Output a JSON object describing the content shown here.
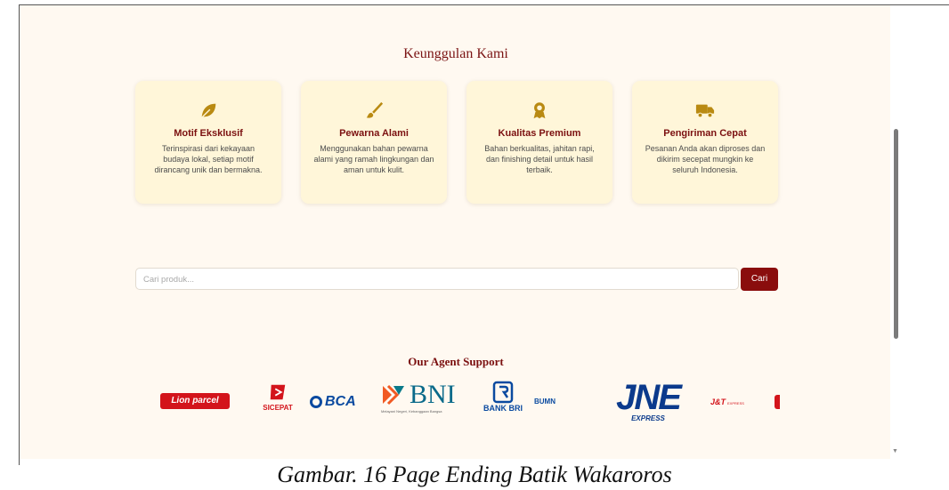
{
  "section": {
    "title": "Keunggulan Kami",
    "cards": [
      {
        "icon": "leaf-icon",
        "title": "Motif Eksklusif",
        "desc": "Terinspirasi dari kekayaan budaya lokal, setiap motif dirancang unik dan bermakna."
      },
      {
        "icon": "paintbrush-icon",
        "title": "Pewarna Alami",
        "desc": "Menggunakan bahan pewarna alami yang ramah lingkungan dan aman untuk kulit."
      },
      {
        "icon": "award-icon",
        "title": "Kualitas Premium",
        "desc": "Bahan berkualitas, jahitan rapi, dan finishing detail untuk hasil terbaik."
      },
      {
        "icon": "truck-icon",
        "title": "Pengiriman Cepat",
        "desc": "Pesanan Anda akan diproses dan dikirim secepat mungkin ke seluruh Indonesia."
      }
    ]
  },
  "search": {
    "placeholder": "Cari produk...",
    "button": "Cari"
  },
  "agents": {
    "title": "Our Agent Support",
    "logos": {
      "lion": "Lion parcel",
      "sicepat": "SICEPAT",
      "bca": "BCA",
      "bni": "BNI",
      "bni_tagline": "Melayani Negeri, Kebanggaan Bangsa",
      "bri": "BANK BRI",
      "bumn": "BUMN",
      "jne": "JNE",
      "jne_sub": "EXPRESS",
      "jt": "J&T",
      "jt_sub": "EXPRESS"
    }
  },
  "caption": "Gambar. 16 Page Ending Batik Wakaroros",
  "colors": {
    "accent": "#8a0d0d",
    "icon": "#b98a12",
    "page_bg": "#fff9f1",
    "card_bg": "#fff6d9"
  }
}
